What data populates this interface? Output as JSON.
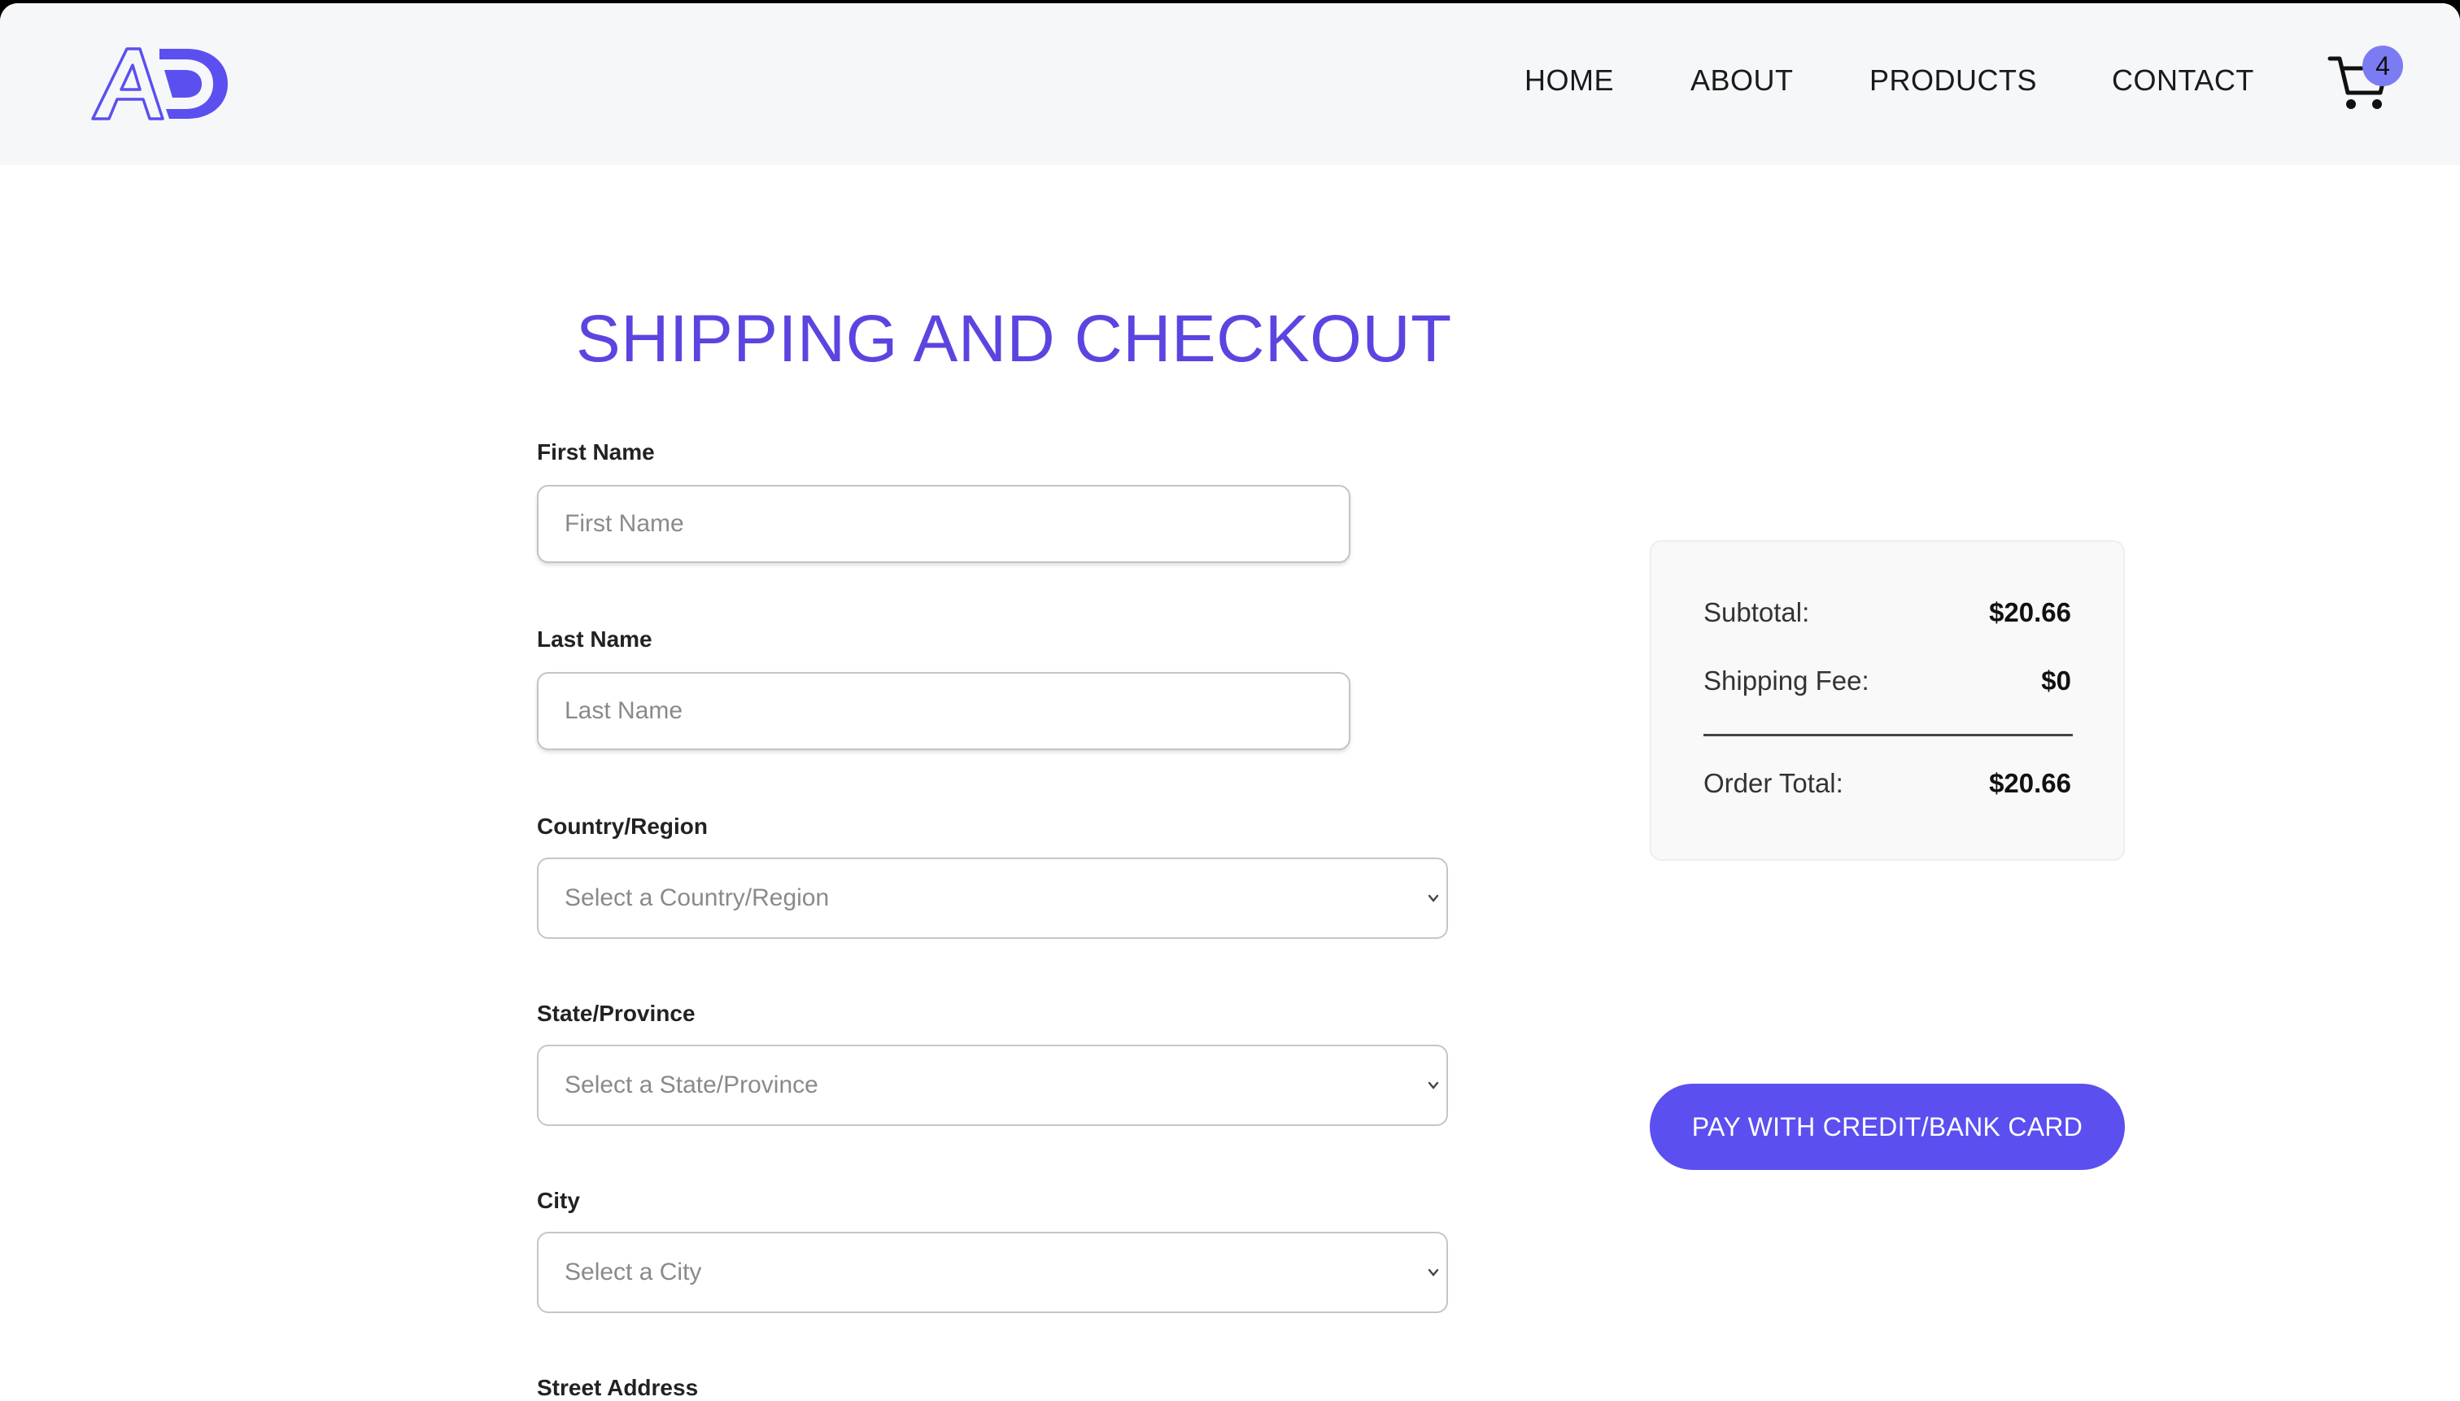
{
  "header": {
    "logo_text": "AD",
    "nav": [
      "HOME",
      "ABOUT",
      "PRODUCTS",
      "CONTACT"
    ],
    "cart_count": "4"
  },
  "page": {
    "title": "SHIPPING AND CHECKOUT"
  },
  "form": {
    "first_name": {
      "label": "First Name",
      "placeholder": "First Name",
      "value": ""
    },
    "last_name": {
      "label": "Last Name",
      "placeholder": "Last Name",
      "value": ""
    },
    "country": {
      "label": "Country/Region",
      "placeholder": "Select a Country/Region"
    },
    "state": {
      "label": "State/Province",
      "placeholder": "Select a State/Province"
    },
    "city": {
      "label": "City",
      "placeholder": "Select a City"
    },
    "street": {
      "label": "Street Address"
    }
  },
  "summary": {
    "subtotal_label": "Subtotal:",
    "subtotal_value": "$20.66",
    "shipping_label": "Shipping Fee:",
    "shipping_value": "$0",
    "total_label": "Order Total:",
    "total_value": "$20.66"
  },
  "actions": {
    "pay_label": "PAY WITH CREDIT/BANK CARD"
  },
  "colors": {
    "accent": "#5b4ff0",
    "title": "#5b45e0",
    "badge": "#7c7cf2",
    "header_bg": "#f6f7f9"
  }
}
